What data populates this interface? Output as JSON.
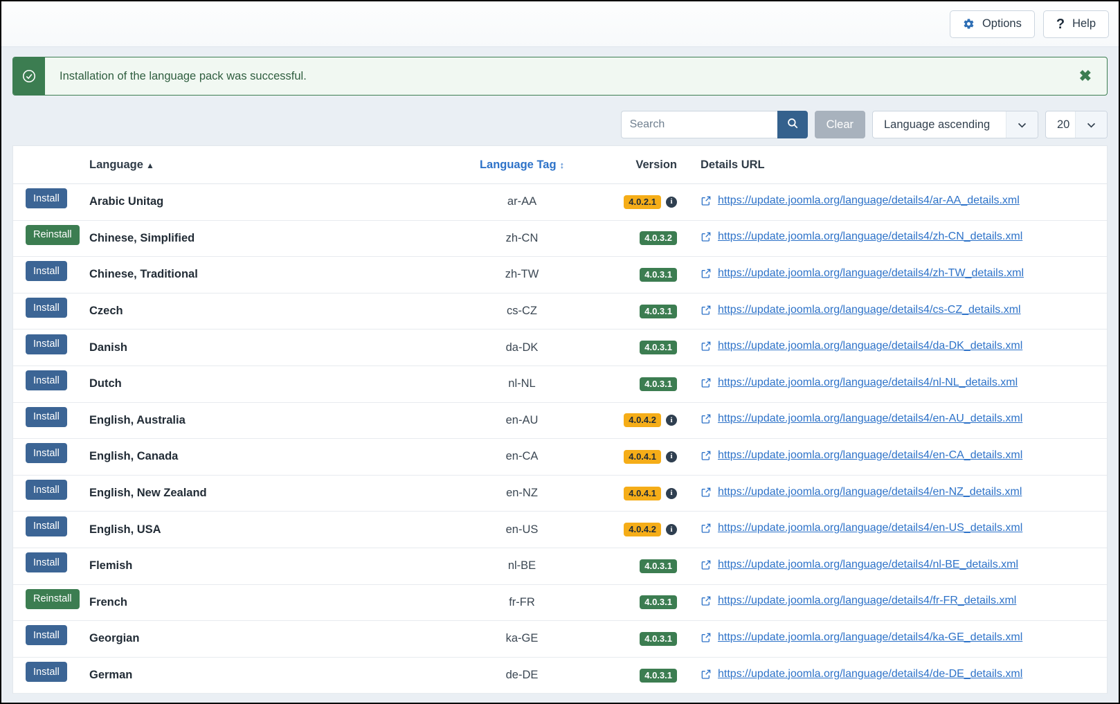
{
  "toolbar": {
    "options_label": "Options",
    "help_label": "Help",
    "gear_icon": "gear-icon",
    "help_icon": "question-mark-icon"
  },
  "alert": {
    "message": "Installation of the language pack was successful.",
    "icon": "check-circle-icon",
    "close_icon": "close-icon",
    "close_label": "✖",
    "accent_color": "#3c7d51",
    "background_color": "#f1f8f2"
  },
  "filters": {
    "search_value": "",
    "search_placeholder": "Search",
    "search_icon": "search-icon",
    "clear_label": "Clear",
    "sort_value": "Language ascending",
    "limit_value": "20",
    "chevron_icon": "chevron-down-icon"
  },
  "table": {
    "headers": {
      "action": "",
      "language": "Language",
      "language_sort_indicator": "▲",
      "language_tag": "Language Tag",
      "language_tag_sort_indicator": "↕",
      "version": "Version",
      "details_url": "Details URL"
    },
    "rows": [
      {
        "action": "Install",
        "action_type": "install",
        "language": "Arabic Unitag",
        "tag": "ar-AA",
        "version": "4.0.2.1",
        "version_state": "yellow",
        "has_info": true,
        "url": "https://update.joomla.org/language/details4/ar-AA_details.xml"
      },
      {
        "action": "Reinstall",
        "action_type": "reinstall",
        "language": "Chinese, Simplified",
        "tag": "zh-CN",
        "version": "4.0.3.2",
        "version_state": "green",
        "has_info": false,
        "url": "https://update.joomla.org/language/details4/zh-CN_details.xml"
      },
      {
        "action": "Install",
        "action_type": "install",
        "language": "Chinese, Traditional",
        "tag": "zh-TW",
        "version": "4.0.3.1",
        "version_state": "green",
        "has_info": false,
        "url": "https://update.joomla.org/language/details4/zh-TW_details.xml"
      },
      {
        "action": "Install",
        "action_type": "install",
        "language": "Czech",
        "tag": "cs-CZ",
        "version": "4.0.3.1",
        "version_state": "green",
        "has_info": false,
        "url": "https://update.joomla.org/language/details4/cs-CZ_details.xml"
      },
      {
        "action": "Install",
        "action_type": "install",
        "language": "Danish",
        "tag": "da-DK",
        "version": "4.0.3.1",
        "version_state": "green",
        "has_info": false,
        "url": "https://update.joomla.org/language/details4/da-DK_details.xml"
      },
      {
        "action": "Install",
        "action_type": "install",
        "language": "Dutch",
        "tag": "nl-NL",
        "version": "4.0.3.1",
        "version_state": "green",
        "has_info": false,
        "url": "https://update.joomla.org/language/details4/nl-NL_details.xml"
      },
      {
        "action": "Install",
        "action_type": "install",
        "language": "English, Australia",
        "tag": "en-AU",
        "version": "4.0.4.2",
        "version_state": "yellow",
        "has_info": true,
        "url": "https://update.joomla.org/language/details4/en-AU_details.xml"
      },
      {
        "action": "Install",
        "action_type": "install",
        "language": "English, Canada",
        "tag": "en-CA",
        "version": "4.0.4.1",
        "version_state": "yellow",
        "has_info": true,
        "url": "https://update.joomla.org/language/details4/en-CA_details.xml"
      },
      {
        "action": "Install",
        "action_type": "install",
        "language": "English, New Zealand",
        "tag": "en-NZ",
        "version": "4.0.4.1",
        "version_state": "yellow",
        "has_info": true,
        "url": "https://update.joomla.org/language/details4/en-NZ_details.xml"
      },
      {
        "action": "Install",
        "action_type": "install",
        "language": "English, USA",
        "tag": "en-US",
        "version": "4.0.4.2",
        "version_state": "yellow",
        "has_info": true,
        "url": "https://update.joomla.org/language/details4/en-US_details.xml"
      },
      {
        "action": "Install",
        "action_type": "install",
        "language": "Flemish",
        "tag": "nl-BE",
        "version": "4.0.3.1",
        "version_state": "green",
        "has_info": false,
        "url": "https://update.joomla.org/language/details4/nl-BE_details.xml"
      },
      {
        "action": "Reinstall",
        "action_type": "reinstall",
        "language": "French",
        "tag": "fr-FR",
        "version": "4.0.3.1",
        "version_state": "green",
        "has_info": false,
        "url": "https://update.joomla.org/language/details4/fr-FR_details.xml"
      },
      {
        "action": "Install",
        "action_type": "install",
        "language": "Georgian",
        "tag": "ka-GE",
        "version": "4.0.3.1",
        "version_state": "green",
        "has_info": false,
        "url": "https://update.joomla.org/language/details4/ka-GE_details.xml"
      },
      {
        "action": "Install",
        "action_type": "install",
        "language": "German",
        "tag": "de-DE",
        "version": "4.0.3.1",
        "version_state": "green",
        "has_info": false,
        "url": "https://update.joomla.org/language/details4/de-DE_details.xml"
      }
    ]
  },
  "colors": {
    "install_button": "#3c6595",
    "reinstall_button": "#3c7d51",
    "link": "#2d72c8",
    "badge_green": "#3c7d51",
    "badge_yellow": "#f5ad18",
    "page_background": "#eaeff4"
  }
}
